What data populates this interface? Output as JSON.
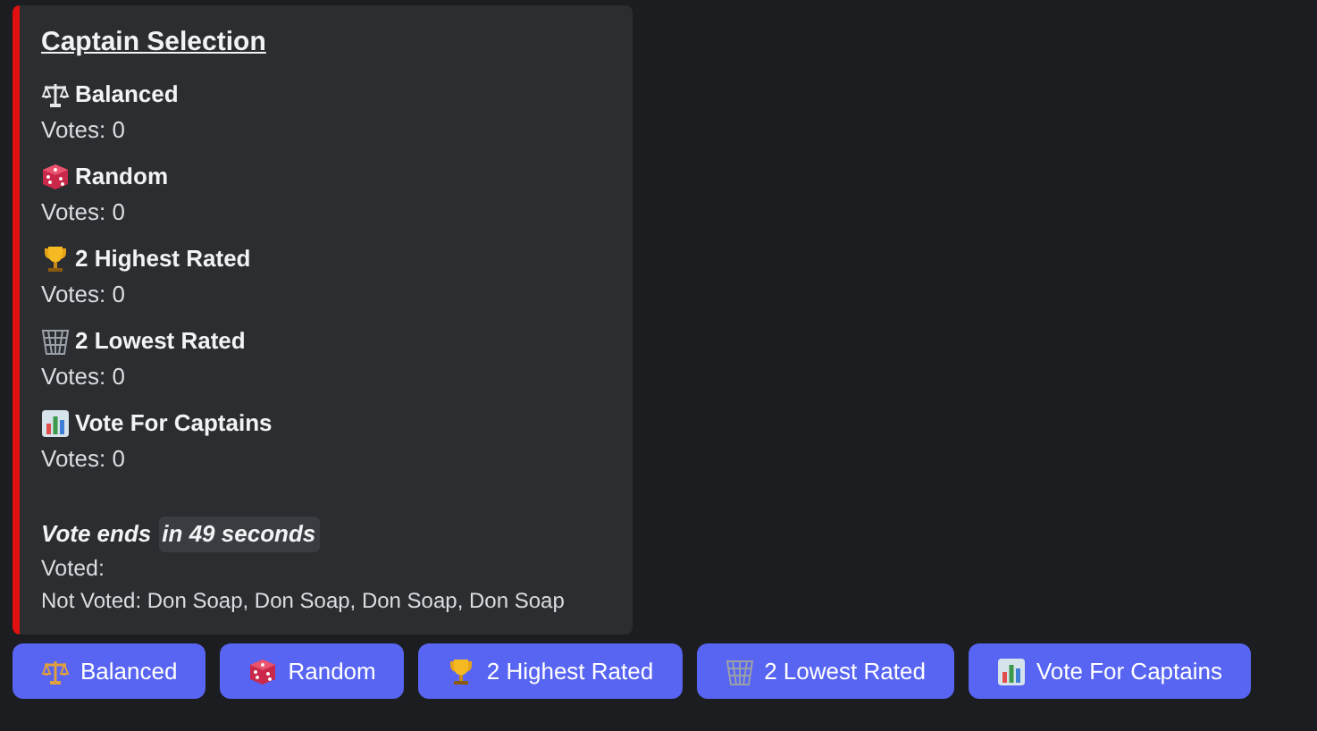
{
  "embed": {
    "title": "Captain Selection",
    "options": [
      {
        "name": "Balanced",
        "votes": "Votes: 0"
      },
      {
        "name": "Random",
        "votes": "Votes: 0"
      },
      {
        "name": "2 Highest Rated",
        "votes": "Votes: 0"
      },
      {
        "name": "2 Lowest Rated",
        "votes": "Votes: 0"
      },
      {
        "name": "Vote For Captains",
        "votes": "Votes: 0"
      }
    ],
    "vote_end": {
      "label": "Vote ends",
      "timestamp": "in 49 seconds"
    },
    "voted": "Voted:",
    "not_voted": "Not Voted: Don Soap, Don Soap, Don Soap, Don Soap"
  },
  "buttons": [
    "Balanced",
    "Random",
    "2 Highest Rated",
    "2 Lowest Rated",
    "Vote For Captains"
  ]
}
